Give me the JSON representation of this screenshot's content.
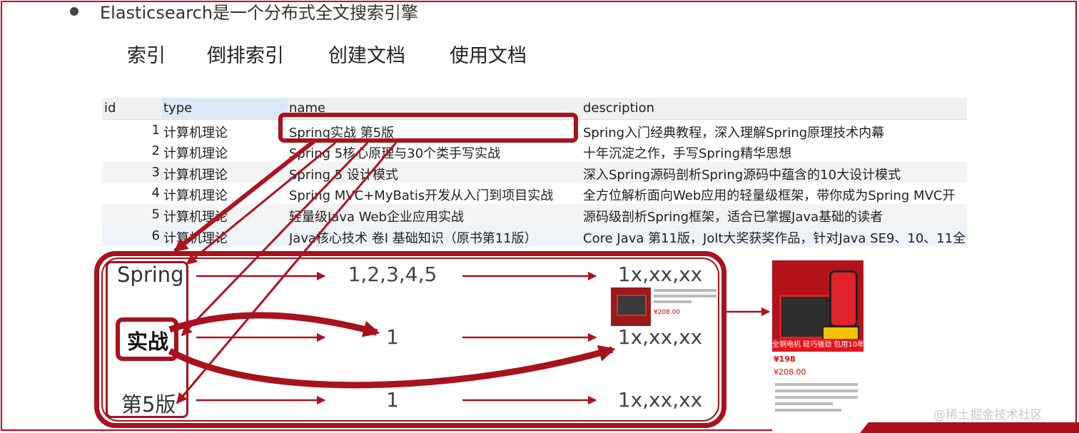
{
  "heading": "Elasticsearch是一个分布式全文搜索引擎",
  "topics": [
    "索引",
    "倒排索引",
    "创建文档",
    "使用文档"
  ],
  "table": {
    "columns": [
      "id",
      "type",
      "name",
      "description"
    ],
    "rows": [
      {
        "id": "1",
        "type": "计算机理论",
        "name": "Spring实战 第5版",
        "description": "Spring入门经典教程，深入理解Spring原理技术内幕"
      },
      {
        "id": "2",
        "type": "计算机理论",
        "name": "Spring 5核心原理与30个类手写实战",
        "description": "十年沉淀之作，手写Spring精华思想"
      },
      {
        "id": "3",
        "type": "计算机理论",
        "name": "Spring 5 设计模式",
        "description": "深入Spring源码剖析Spring源码中蕴含的10大设计模式"
      },
      {
        "id": "4",
        "type": "计算机理论",
        "name": "Spring MVC+MyBatis开发从入门到项目实战",
        "description": "全方位解析面向Web应用的轻量级框架，带你成为Spring MVC开"
      },
      {
        "id": "5",
        "type": "计算机理论",
        "name": "轻量级Java Web企业应用实战",
        "description": "源码级剖析Spring框架，适合已掌握Java基础的读者"
      },
      {
        "id": "6",
        "type": "计算机理论",
        "name": "Java核心技术 卷I 基础知识（原书第11版）",
        "description": "Core Java 第11版，Jolt大奖获奖作品，针对Java SE9、10、11全"
      }
    ]
  },
  "index": {
    "terms": [
      "Spring",
      "实战",
      "第5版"
    ],
    "doc_ids": [
      "1,2,3,4,5",
      "1",
      "1"
    ],
    "doc_values": [
      "1x,xx,xx",
      "1x,xx,xx",
      "1x,xx,xx"
    ]
  },
  "product": {
    "banner": "全铜电机 轻巧强劲 包用10年",
    "price_small": "¥208.00",
    "price_big_1": "¥198",
    "price_big_2": "¥208.00"
  },
  "watermark": "@稀土掘金技术社区",
  "colors": {
    "accent": "#a8111d",
    "frame": "#c0001a",
    "header_highlight": "#dbe9f7"
  }
}
